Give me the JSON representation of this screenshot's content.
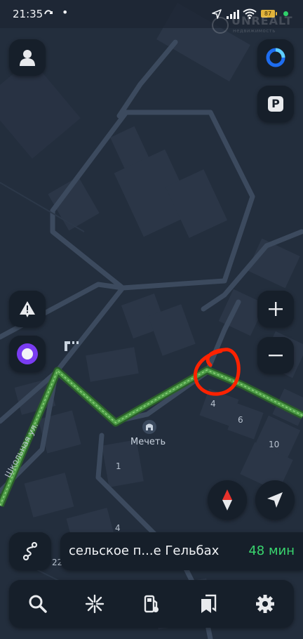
{
  "status_bar": {
    "time": "21:35",
    "battery": "87"
  },
  "watermark": {
    "brand": "UNREALT",
    "sub": "недвижимость"
  },
  "map": {
    "poi_label": "Мечеть",
    "street_label": "Школьная ул.",
    "house_numbers": [
      "4",
      "6",
      "10",
      "1",
      "4",
      "22"
    ]
  },
  "controls": {
    "parking_label": "P",
    "zoom_in": "+",
    "zoom_out": "−"
  },
  "route": {
    "destination": "сельское п...е Гельбах",
    "eta": "48 мин"
  },
  "nav_tabs": [
    "search-icon",
    "discovery-icon",
    "fuel-icon",
    "bookmarks-icon",
    "settings-icon"
  ],
  "colors": {
    "map_bg": "#232e3d",
    "route": "#3f8a3b",
    "eta": "#39d56e",
    "annotation": "#ff2200"
  }
}
